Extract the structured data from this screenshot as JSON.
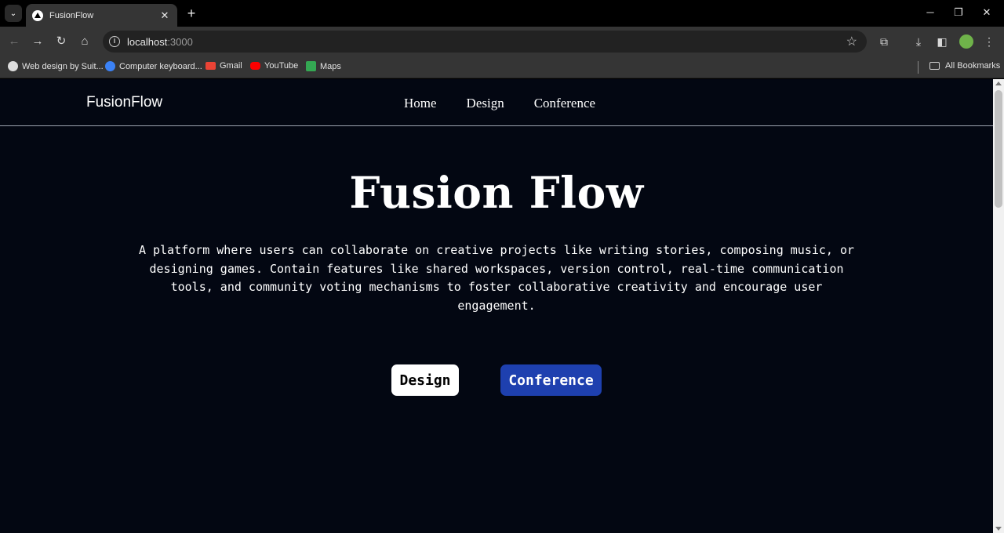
{
  "browser": {
    "tab_title": "FusionFlow",
    "url_host": "localhost",
    "url_port": ":3000",
    "bookmarks": [
      {
        "label": "Web design by Suit..."
      },
      {
        "label": "Computer keyboard..."
      },
      {
        "label": "Gmail"
      },
      {
        "label": "YouTube"
      },
      {
        "label": "Maps"
      }
    ],
    "all_bookmarks": "All Bookmarks"
  },
  "site": {
    "brand": "FusionFlow",
    "nav": [
      "Home",
      "Design",
      "Conference"
    ]
  },
  "hero": {
    "title": "Fusion Flow",
    "description": "A platform where users can collaborate on creative projects like writing stories, composing music, or designing games. Contain features like shared workspaces, version control, real-time communication tools, and community voting mechanisms to foster collaborative creativity and encourage user engagement.",
    "buttons": {
      "design": "Design",
      "conference": "Conference"
    }
  },
  "colors": {
    "page_background": "#030712",
    "conference_button": "#1e40af",
    "design_button": "#ffffff"
  }
}
